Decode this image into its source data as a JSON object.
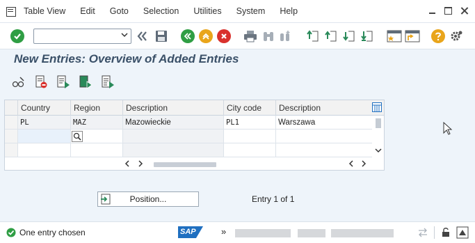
{
  "menu": {
    "items": [
      "Table View",
      "Edit",
      "Goto",
      "Selection",
      "Utilities",
      "System",
      "Help"
    ]
  },
  "toolbar": {
    "command_field_value": "",
    "colors": {
      "green": "#2f9e44",
      "orange": "#e9a51b",
      "red": "#d9312d",
      "gray": "#5f6b78",
      "teal": "#2a8a5a"
    }
  },
  "page": {
    "title": "New Entries: Overview of Added Entries"
  },
  "table": {
    "columns": [
      "Country",
      "Region",
      "Description",
      "City code",
      "Description"
    ],
    "rows": [
      [
        "PL",
        "MAZ",
        "Mazowieckie",
        "PL1",
        "Warszawa"
      ],
      [
        "",
        "",
        "",
        "",
        ""
      ],
      [
        "",
        "",
        "",
        "",
        ""
      ]
    ]
  },
  "position_button": {
    "label": "Position..."
  },
  "entry_info": "Entry 1 of 1",
  "status": {
    "message": "One entry chosen",
    "sap_logo": "SAP",
    "more": "»"
  }
}
